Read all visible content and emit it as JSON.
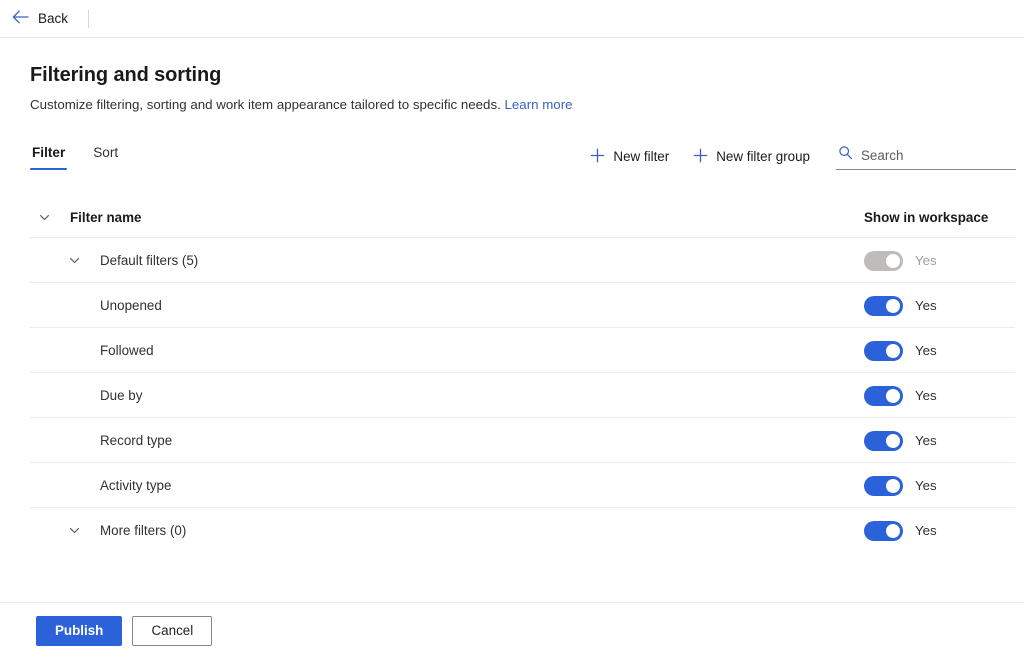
{
  "topbar": {
    "back_label": "Back",
    "back_icon": "arrow-left-icon",
    "accent": "#3b5fc4"
  },
  "page": {
    "title": "Filtering and sorting",
    "subtitle": "Customize filtering, sorting and work item appearance tailored to specific needs.",
    "learn_more": "Learn more"
  },
  "tabs": [
    {
      "label": "Filter",
      "active": true
    },
    {
      "label": "Sort",
      "active": false
    }
  ],
  "commands": {
    "new_filter": "New filter",
    "new_filter_group": "New filter group",
    "plus_icon": "plus-icon",
    "search_icon": "search-icon",
    "search_placeholder": "Search",
    "search_value": ""
  },
  "table": {
    "columns": {
      "name": "Filter name",
      "show": "Show in workspace"
    },
    "rows": [
      {
        "label": "Default filters (5)",
        "level": 1,
        "expandable": true,
        "toggle_on": true,
        "toggle_disabled": true,
        "toggle_label": "Yes"
      },
      {
        "label": "Unopened",
        "level": 2,
        "expandable": false,
        "toggle_on": true,
        "toggle_disabled": false,
        "toggle_label": "Yes"
      },
      {
        "label": "Followed",
        "level": 2,
        "expandable": false,
        "toggle_on": true,
        "toggle_disabled": false,
        "toggle_label": "Yes"
      },
      {
        "label": "Due by",
        "level": 2,
        "expandable": false,
        "toggle_on": true,
        "toggle_disabled": false,
        "toggle_label": "Yes"
      },
      {
        "label": "Record type",
        "level": 2,
        "expandable": false,
        "toggle_on": true,
        "toggle_disabled": false,
        "toggle_label": "Yes"
      },
      {
        "label": "Activity type",
        "level": 2,
        "expandable": false,
        "toggle_on": true,
        "toggle_disabled": false,
        "toggle_label": "Yes"
      },
      {
        "label": "More filters (0)",
        "level": 1,
        "expandable": true,
        "toggle_on": true,
        "toggle_disabled": false,
        "toggle_label": "Yes"
      }
    ]
  },
  "footer": {
    "publish": "Publish",
    "cancel": "Cancel"
  },
  "colors": {
    "accent_blue": "#2b62d9",
    "link_blue": "#3b5fc4",
    "toggle_off_grey": "#bebbb8",
    "divider": "#ececec"
  }
}
